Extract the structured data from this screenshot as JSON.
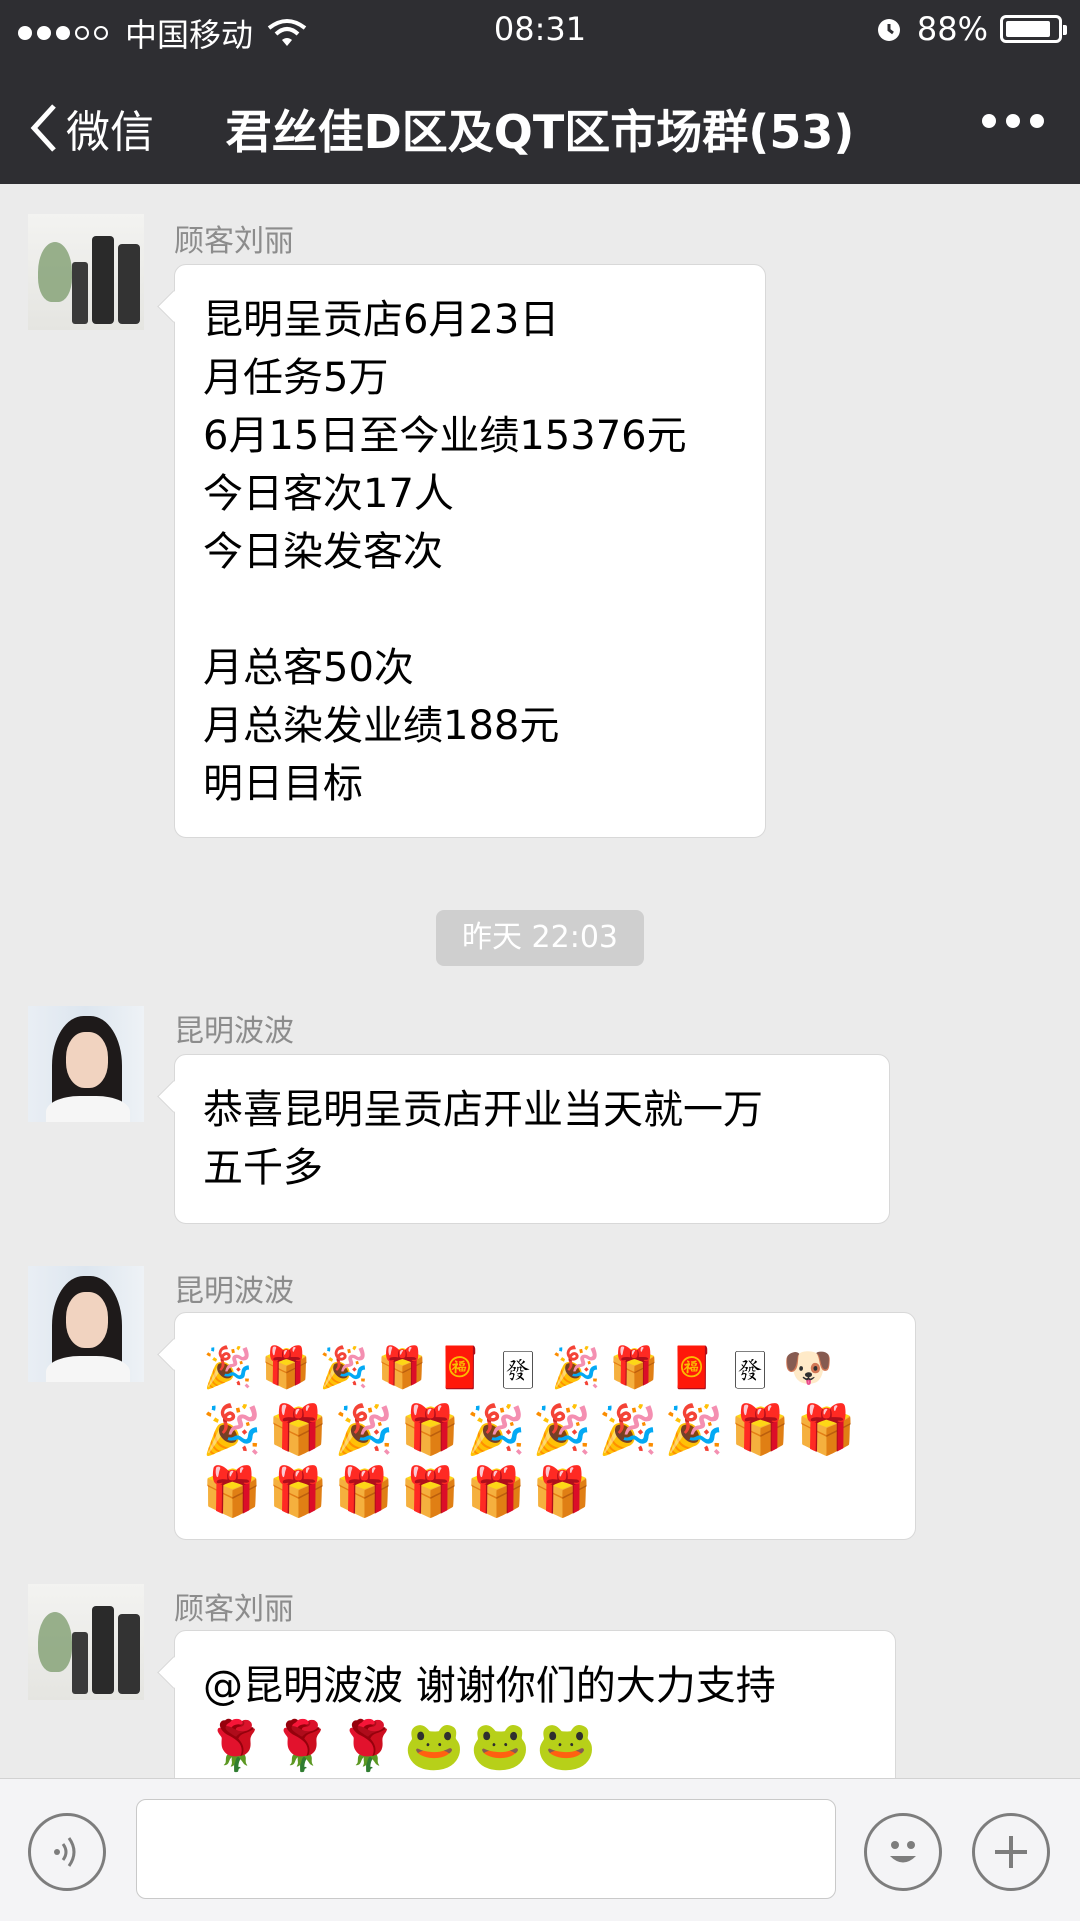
{
  "status_bar": {
    "carrier": "中国移动",
    "time": "08:31",
    "battery": "88%",
    "battery_level": 0.88,
    "signal_bars": 3
  },
  "nav": {
    "back_label": "微信",
    "title": "君丝佳D区及QT区市场群(53)",
    "icons": [
      "chevron-left-icon",
      "more-icon"
    ]
  },
  "messages": [
    {
      "sender": "顾客刘丽",
      "avatar": "product-avatar",
      "lines": [
        "昆明呈贡店6月23日",
        "月任务5万",
        "6月15日至今业绩15376元",
        "今日客次17人",
        "今日染发客次",
        "",
        "月总客50次",
        "月总染发业绩188元",
        "明日目标"
      ]
    },
    {
      "sender": "昆明波波",
      "avatar": "person-avatar",
      "lines": [
        "恭喜昆明呈贡店开业当天就一万",
        "五千多"
      ]
    },
    {
      "sender": "昆明波波",
      "avatar": "person-avatar",
      "emoji_rows": [
        [
          "🎉",
          "🎁",
          "🎉",
          "🎁",
          "🧧",
          "🀅",
          "🎉",
          "🎁",
          "🧧",
          "🀅",
          "🐶"
        ],
        [
          "🎉",
          "🎁",
          "🎉",
          "🎁",
          "🎉",
          "🎉",
          "🎉",
          "🎉",
          "🎁",
          "🎁"
        ],
        [
          "🎁",
          "🎁",
          "🎁",
          "🎁",
          "🎁",
          "🎁"
        ]
      ]
    },
    {
      "sender": "顾客刘丽",
      "avatar": "product-avatar",
      "lines": [
        "@昆明波波 谢谢你们的大力支持"
      ],
      "emoji_rows": [
        [
          "🌹",
          "🌹",
          "🌹",
          "🐸",
          "🐸",
          "🐸"
        ]
      ]
    }
  ],
  "timestamp": "昨天 22:03",
  "input_bar": {
    "value": "",
    "icons": [
      "voice-icon",
      "emoji-icon",
      "plus-icon"
    ]
  }
}
